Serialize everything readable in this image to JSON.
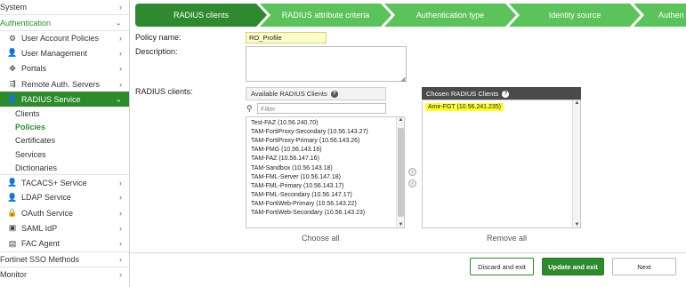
{
  "sidebar": {
    "top_system": "System",
    "top_authentication": "Authentication",
    "items": [
      {
        "label": "User Account Policies",
        "icon": "gear-icon"
      },
      {
        "label": "User Management",
        "icon": "user-icon"
      },
      {
        "label": "Portals",
        "icon": "portals-icon"
      },
      {
        "label": "Remote Auth. Servers",
        "icon": "server-icon"
      },
      {
        "label": "RADIUS Service",
        "icon": "radius-icon"
      }
    ],
    "radius_sub": [
      "Clients",
      "Policies",
      "Certificates",
      "Services",
      "Dictionaries"
    ],
    "items2": [
      {
        "label": "TACACS+ Service",
        "icon": "tacacs-icon"
      },
      {
        "label": "LDAP Service",
        "icon": "ldap-icon"
      },
      {
        "label": "OAuth Service",
        "icon": "oauth-icon"
      },
      {
        "label": "SAML IdP",
        "icon": "saml-icon"
      },
      {
        "label": "FAC Agent",
        "icon": "agent-icon"
      }
    ],
    "top_fsso": "Fortinet SSO Methods",
    "top_monitor": "Monitor"
  },
  "wizard": {
    "steps": [
      "RADIUS clients",
      "RADIUS attribute criteria",
      "Authentication type",
      "Identity source",
      "Authen"
    ]
  },
  "form": {
    "policy_name_label": "Policy name:",
    "policy_name_value": "RO_Profile",
    "description_label": "Description:",
    "radius_clients_label": "RADIUS clients:"
  },
  "available": {
    "title": "Available RADIUS Clients",
    "filter_placeholder": "Filter",
    "items": [
      "Test-FAZ (10.56.240.70)",
      "TAM-FortiProxy-Secondary (10.56.143.27)",
      "TAM-FortiProxy-Primary (10.56.143.26)",
      "TAM-FMG (10.56.143.16)",
      "TAM-FAZ (10.56.147.16)",
      "TAM-Sandbox (10.56.143.18)",
      "TAM-FML-Server (10.56.147.18)",
      "TAM-FML-Primary (10.56.143.17)",
      "TAM-FML-Secondary (10.56.147.17)",
      "TAM-FortiWeb-Primary (10.56.143.22)",
      "TAM-FortiWeb-Secondary (10.56.143.23)"
    ],
    "choose_all": "Choose all"
  },
  "chosen": {
    "title": "Chosen RADIUS Clients",
    "items": [
      "Amir-FGT (10.56.241.235)"
    ],
    "remove_all": "Remove all"
  },
  "buttons": {
    "discard": "Discard and exit",
    "update": "Update and exit",
    "next": "Next"
  },
  "colors": {
    "accent": "#2f8a2f",
    "step_light": "#5cc35c",
    "highlight": "#ffff33"
  }
}
